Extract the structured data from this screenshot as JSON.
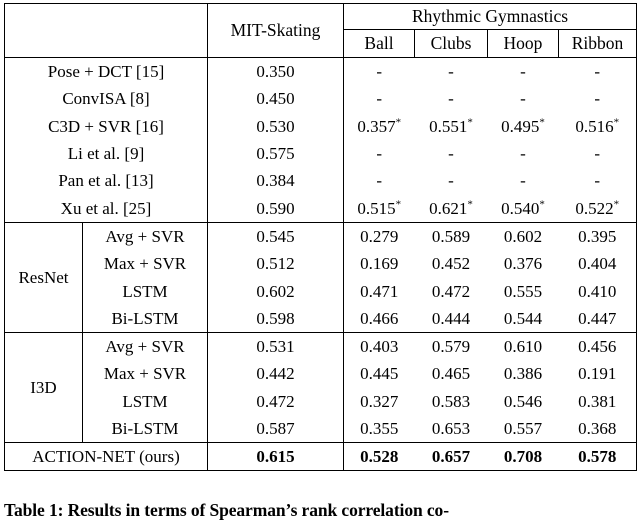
{
  "table": {
    "header": {
      "blank_label": "",
      "col_mit": "MIT-Skating",
      "group_rg": "Rhythmic Gymnastics",
      "sub_ball": "Ball",
      "sub_clubs": "Clubs",
      "sub_hoop": "Hoop",
      "sub_ribbon": "Ribbon"
    },
    "literature_rows": [
      {
        "method": "Pose + DCT [15]",
        "mit": "0.350",
        "ball": "-",
        "clubs": "-",
        "hoop": "-",
        "ribbon": "-",
        "star": false
      },
      {
        "method": "ConvISA [8]",
        "mit": "0.450",
        "ball": "-",
        "clubs": "-",
        "hoop": "-",
        "ribbon": "-",
        "star": false
      },
      {
        "method": "C3D + SVR [16]",
        "mit": "0.530",
        "ball": "0.357",
        "clubs": "0.551",
        "hoop": "0.495",
        "ribbon": "0.516",
        "star": true
      },
      {
        "method": "Li et al. [9]",
        "mit": "0.575",
        "ball": "-",
        "clubs": "-",
        "hoop": "-",
        "ribbon": "-",
        "star": false
      },
      {
        "method": "Pan et al. [13]",
        "mit": "0.384",
        "ball": "-",
        "clubs": "-",
        "hoop": "-",
        "ribbon": "-",
        "star": false
      },
      {
        "method": "Xu et al. [25]",
        "mit": "0.590",
        "ball": "0.515",
        "clubs": "0.621",
        "hoop": "0.540",
        "ribbon": "0.522",
        "star": true
      }
    ],
    "resnet_group": {
      "label": "ResNet",
      "rows": [
        {
          "variant": "Avg + SVR",
          "mit": "0.545",
          "ball": "0.279",
          "clubs": "0.589",
          "hoop": "0.602",
          "ribbon": "0.395"
        },
        {
          "variant": "Max + SVR",
          "mit": "0.512",
          "ball": "0.169",
          "clubs": "0.452",
          "hoop": "0.376",
          "ribbon": "0.404"
        },
        {
          "variant": "LSTM",
          "mit": "0.602",
          "ball": "0.471",
          "clubs": "0.472",
          "hoop": "0.555",
          "ribbon": "0.410"
        },
        {
          "variant": "Bi-LSTM",
          "mit": "0.598",
          "ball": "0.466",
          "clubs": "0.444",
          "hoop": "0.544",
          "ribbon": "0.447"
        }
      ]
    },
    "i3d_group": {
      "label": "I3D",
      "rows": [
        {
          "variant": "Avg + SVR",
          "mit": "0.531",
          "ball": "0.403",
          "clubs": "0.579",
          "hoop": "0.610",
          "ribbon": "0.456"
        },
        {
          "variant": "Max + SVR",
          "mit": "0.442",
          "ball": "0.445",
          "clubs": "0.465",
          "hoop": "0.386",
          "ribbon": "0.191"
        },
        {
          "variant": "LSTM",
          "mit": "0.472",
          "ball": "0.327",
          "clubs": "0.583",
          "hoop": "0.546",
          "ribbon": "0.381"
        },
        {
          "variant": "Bi-LSTM",
          "mit": "0.587",
          "ball": "0.355",
          "clubs": "0.653",
          "hoop": "0.557",
          "ribbon": "0.368"
        }
      ]
    },
    "final_row": {
      "method": "ACTION-NET (ours)",
      "mit": "0.615",
      "ball": "0.528",
      "clubs": "0.657",
      "hoop": "0.708",
      "ribbon": "0.578"
    }
  },
  "caption": {
    "text": "Table 1: Results in terms of Spearman’s rank correlation co-"
  }
}
